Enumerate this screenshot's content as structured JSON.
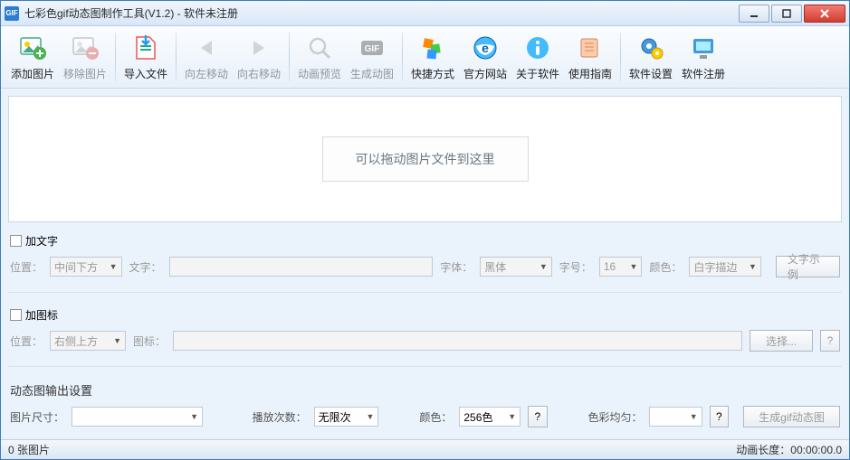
{
  "titlebar": {
    "app_icon_text": "GIF",
    "title": "七彩色gif动态图制作工具(V1.2) - 软件未注册"
  },
  "toolbar": {
    "add_image": "添加图片",
    "remove_image": "移除图片",
    "import_file": "导入文件",
    "move_left": "向左移动",
    "move_right": "向右移动",
    "preview": "动画预览",
    "generate": "生成动图",
    "shortcut": "快捷方式",
    "official_site": "官方网站",
    "about": "关于软件",
    "guide": "使用指南",
    "settings": "软件设置",
    "register": "软件注册"
  },
  "dropzone": {
    "hint": "可以拖动图片文件到这里"
  },
  "text_panel": {
    "checkbox_label": "加文字",
    "pos_label": "位置：",
    "pos_value": "中间下方",
    "text_label": "文字：",
    "font_label": "字体：",
    "font_value": "黑体",
    "size_label": "字号：",
    "size_value": "16",
    "color_label": "颜色：",
    "color_value": "白字描边",
    "sample_btn": "文字示例"
  },
  "icon_panel": {
    "checkbox_label": "加图标",
    "pos_label": "位置：",
    "pos_value": "右侧上方",
    "icon_label": "图标：",
    "browse_btn": "选择...",
    "help_btn": "?"
  },
  "output_panel": {
    "title": "动态图输出设置",
    "size_label": "图片尺寸：",
    "play_label": "播放次数：",
    "play_value": "无限次",
    "color_label": "颜色：",
    "color_value": "256色",
    "avg_label": "色彩均匀：",
    "help": "?",
    "generate_btn": "生成gif动态图"
  },
  "status": {
    "left": "0 张图片",
    "right_label": "动画长度：",
    "right_value": "00:00:00.0"
  }
}
